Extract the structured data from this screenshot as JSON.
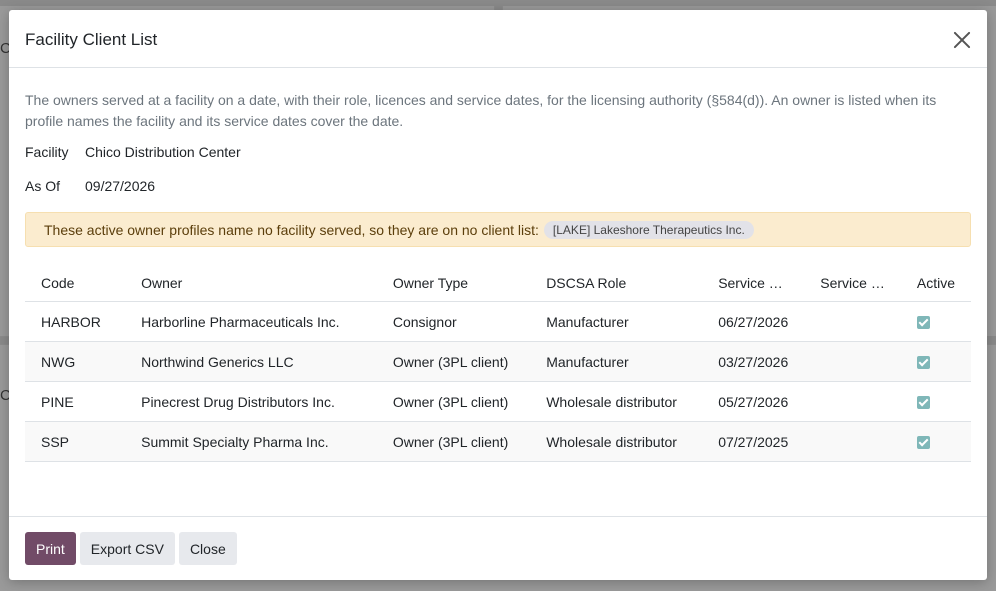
{
  "background": {
    "frag_a": "Co",
    "frag_c": "Co"
  },
  "modal": {
    "title": "Facility Client List",
    "description": "The owners served at a facility on a date, with their role, licences and service dates, for the licensing authority (§584(d)). An owner is listed when its profile names the facility and its service dates cover the date.",
    "fields": {
      "facility_label": "Facility",
      "facility_value": "Chico Distribution Center",
      "as_of_label": "As Of",
      "as_of_value": "09/27/2026"
    },
    "alert": {
      "text": "These active owner profiles name no facility served, so they are on no client list:",
      "tag": "[LAKE] Lakeshore Therapeutics Inc."
    },
    "table": {
      "columns": [
        "Code",
        "Owner",
        "Owner Type",
        "DSCSA Role",
        "Service …",
        "Service …",
        "Active"
      ],
      "rows": [
        {
          "code": "HARBOR",
          "owner": "Harborline Pharmaceuticals Inc.",
          "owner_type": "Consignor",
          "role": "Manufacturer",
          "service_start": "06/27/2026",
          "service_end": "",
          "active": true
        },
        {
          "code": "NWG",
          "owner": "Northwind Generics LLC",
          "owner_type": "Owner (3PL client)",
          "role": "Manufacturer",
          "service_start": "03/27/2026",
          "service_end": "",
          "active": true
        },
        {
          "code": "PINE",
          "owner": "Pinecrest Drug Distributors Inc.",
          "owner_type": "Owner (3PL client)",
          "role": "Wholesale distributor",
          "service_start": "05/27/2026",
          "service_end": "",
          "active": true
        },
        {
          "code": "SSP",
          "owner": "Summit Specialty Pharma Inc.",
          "owner_type": "Owner (3PL client)",
          "role": "Wholesale distributor",
          "service_start": "07/27/2025",
          "service_end": "",
          "active": true
        }
      ]
    },
    "footer": {
      "print": "Print",
      "export": "Export CSV",
      "close": "Close"
    }
  },
  "colors": {
    "primary": "#714b67",
    "alert_bg": "#fbeccf",
    "checkbox": "#7fb7b8"
  }
}
